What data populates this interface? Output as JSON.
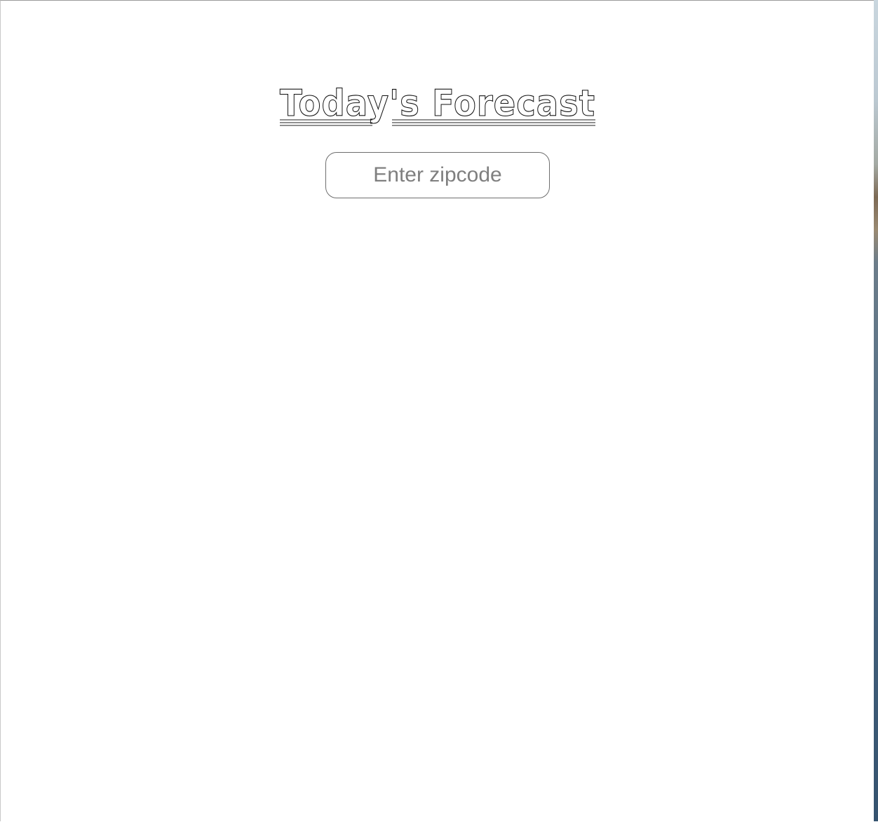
{
  "page": {
    "title": "Today's Forecast"
  },
  "search": {
    "placeholder": "Enter zipcode",
    "value": ""
  },
  "colors": {
    "background": "#ffffff",
    "title_fill": "#ffffff",
    "title_outline": "#111111",
    "input_border": "#6e6e6e",
    "placeholder_text": "#7f7f7f"
  }
}
